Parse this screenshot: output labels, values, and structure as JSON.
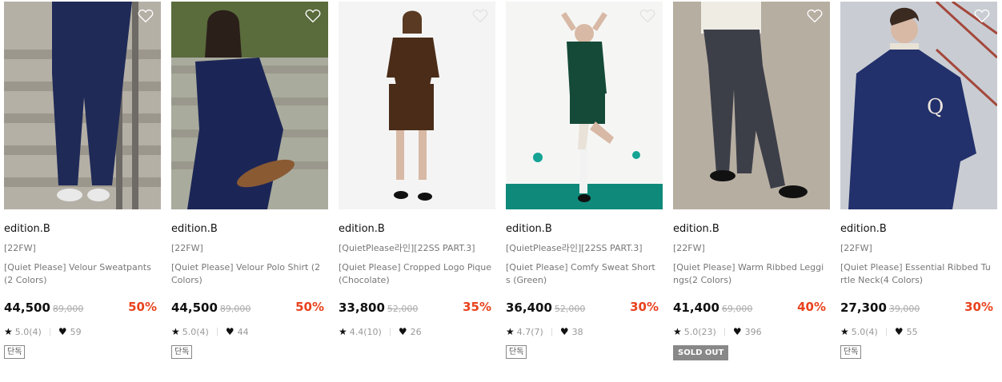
{
  "products": [
    {
      "brand": "edition.B",
      "season": "[22FW]",
      "name": "[Quiet Please] Velour Sweatpants(2 Colors)",
      "price": "44,500",
      "original_price": "89,000",
      "discount": "50%",
      "rating": "5.0(4)",
      "likes": "59",
      "badge": "단독",
      "badge_type": "exclusive"
    },
    {
      "brand": "edition.B",
      "season": "[22FW]",
      "name": "[Quiet Please] Velour Polo Shirt (2 Colors)",
      "price": "44,500",
      "original_price": "89,000",
      "discount": "50%",
      "rating": "5.0(4)",
      "likes": "44",
      "badge": "단독",
      "badge_type": "exclusive"
    },
    {
      "brand": "edition.B",
      "season": "[QuietPlease라인][22SS PART.3]",
      "name": "[Quiet Please] Cropped Logo Pique (Chocolate)",
      "price": "33,800",
      "original_price": "52,000",
      "discount": "35%",
      "rating": "4.4(10)",
      "likes": "26",
      "badge": "",
      "badge_type": ""
    },
    {
      "brand": "edition.B",
      "season": "[QuietPlease라인][22SS PART.3]",
      "name": "[Quiet Please] Comfy Sweat Shorts (Green)",
      "price": "36,400",
      "original_price": "52,000",
      "discount": "30%",
      "rating": "4.7(7)",
      "likes": "38",
      "badge": "단독",
      "badge_type": "exclusive"
    },
    {
      "brand": "edition.B",
      "season": "[22FW]",
      "name": "[Quiet Please] Warm Ribbed Leggings(2 Colors)",
      "price": "41,400",
      "original_price": "69,000",
      "discount": "40%",
      "rating": "5.0(23)",
      "likes": "396",
      "badge": "SOLD OUT",
      "badge_type": "soldout"
    },
    {
      "brand": "edition.B",
      "season": "[22FW]",
      "name": "[Quiet Please] Essential Ribbed Turtle Neck(4 Colors)",
      "price": "27,300",
      "original_price": "39,000",
      "discount": "30%",
      "rating": "5.0(4)",
      "likes": "55",
      "badge": "단독",
      "badge_type": "exclusive"
    }
  ],
  "colors": {
    "discount": "#e8421d",
    "soldout_bg": "#888888"
  },
  "icons": {
    "wishlist": "heart-outline-icon",
    "rating": "star-icon",
    "likes": "heart-filled-icon"
  }
}
